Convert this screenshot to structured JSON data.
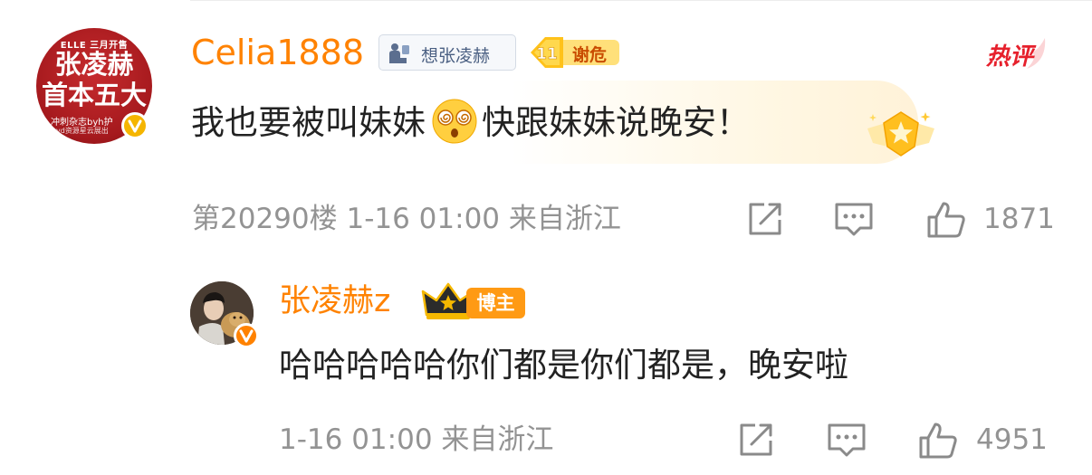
{
  "comment": {
    "avatar": {
      "top_text": "ELLE 三月开售",
      "line1": "张凌赫",
      "line2": "首本五大",
      "small1": "冲刺杂志byh护",
      "small2": "yd资源星云展出"
    },
    "username": "Celia1888",
    "fan_tag": "想张凌赫",
    "level_number": "11",
    "level_tag": "谢危",
    "hot_label": "热评",
    "text_part1": "我也要被叫妹妹",
    "emoji": "dizzy-face-emoji",
    "text_part2": "快跟妹妹说晚安！",
    "meta": "第20290楼 1-16 01:00 来自浙江",
    "like_count": "1871"
  },
  "reply": {
    "username": "张凌赫z",
    "host_badge": "博主",
    "text": "哈哈哈哈哈你们都是你们都是，晚安啦",
    "meta": "1-16 01:00 来自浙江",
    "like_count": "4951"
  },
  "colors": {
    "username": "#ff8200",
    "meta": "#939393",
    "hot": "#e6202c",
    "host_badge": "#ff9a14"
  }
}
